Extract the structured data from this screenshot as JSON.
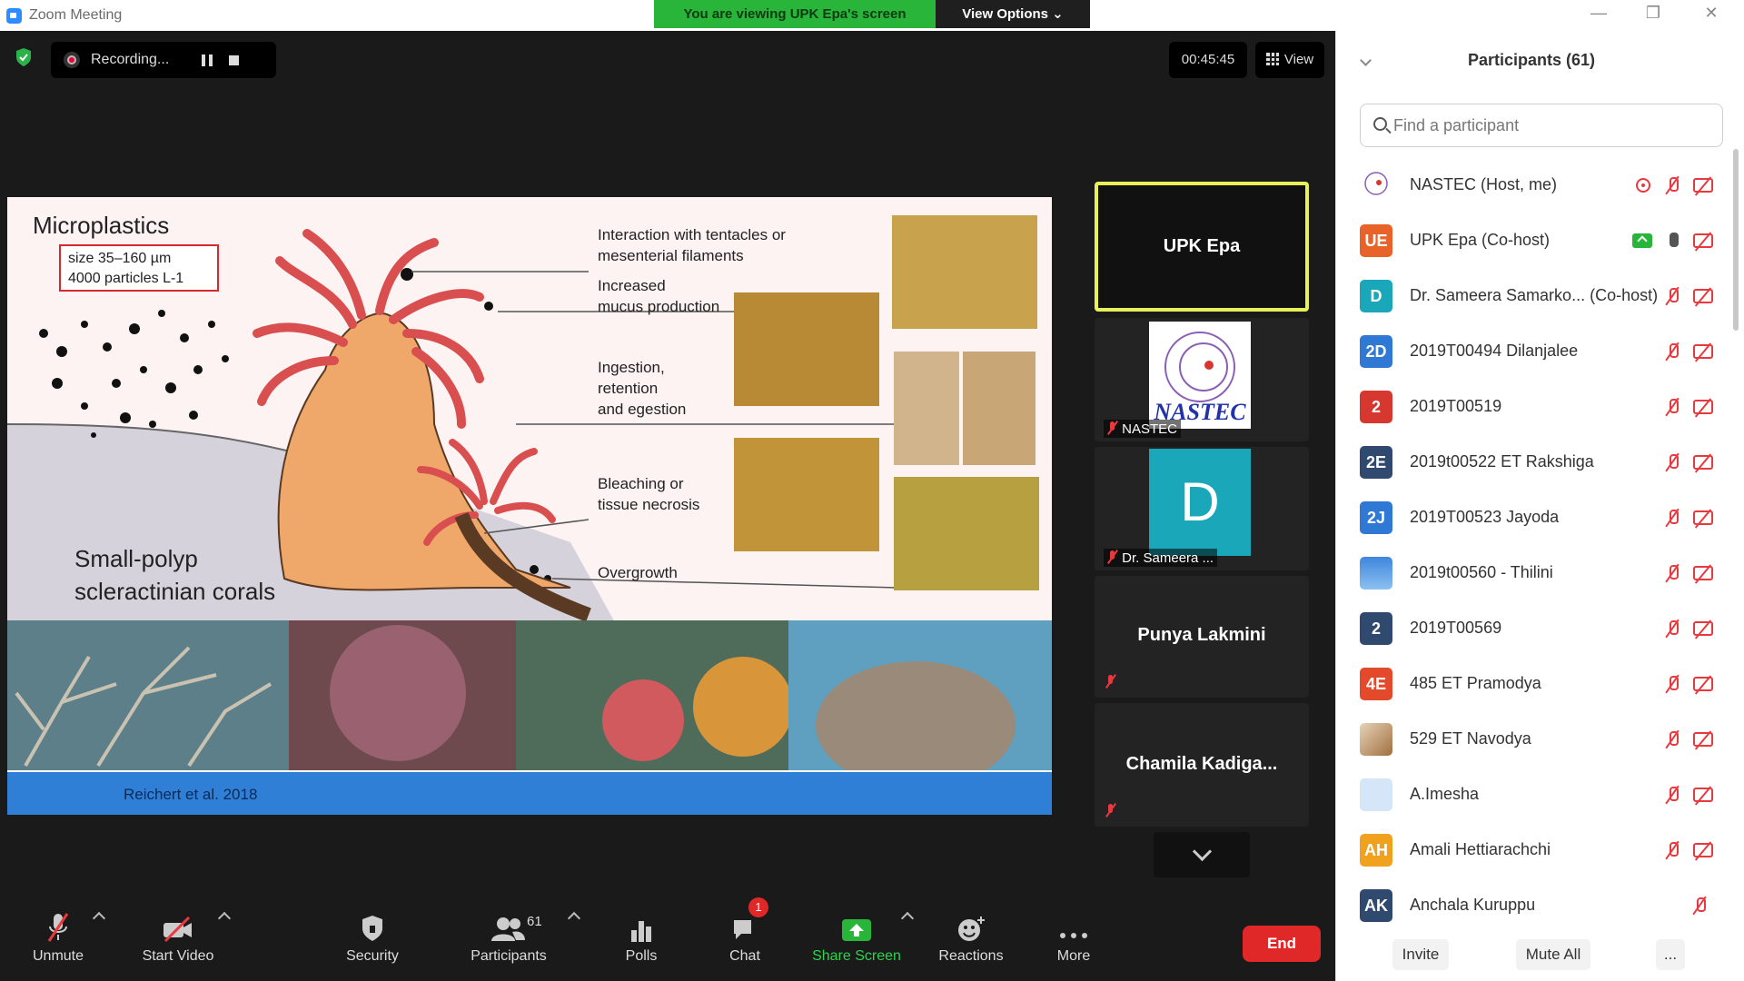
{
  "window": {
    "title": "Zoom Meeting",
    "banner": "You are viewing UPK Epa's screen",
    "view_options": "View Options ⌄",
    "minimize": "—",
    "restore": "❐",
    "close": "✕"
  },
  "meeting": {
    "recording_label": "Recording...",
    "timer": "00:45:45",
    "view_label": "View"
  },
  "slide": {
    "title": "Microplastics",
    "size_line1": "size 35–160 µm",
    "size_line2": "4000 particles L-1",
    "coral_name_line1": "Small-polyp",
    "coral_name_line2": "scleractinian corals",
    "effects": [
      {
        "line1": "Interaction with tentacles or",
        "line2": "mesenterial filaments",
        "line3": ""
      },
      {
        "line1": "Increased",
        "line2": "mucus production",
        "line3": ""
      },
      {
        "line1": "Ingestion,",
        "line2": "retention",
        "line3": "and egestion"
      },
      {
        "line1": "Bleaching or",
        "line2": "tissue necrosis",
        "line3": ""
      },
      {
        "line1": "Overgrowth",
        "line2": "",
        "line3": ""
      }
    ],
    "citation": "Reichert et al. 2018"
  },
  "video_strip": {
    "tiles": [
      {
        "name": "UPK Epa"
      },
      {
        "name": "NASTEC",
        "logo_text": "NASTEC"
      },
      {
        "name": "Dr. Sameera ...",
        "avatar_letter": "D"
      },
      {
        "name": "Punya Lakmini"
      },
      {
        "name": "Chamila  Kadiga..."
      }
    ]
  },
  "toolbar": {
    "unmute": "Unmute",
    "start_video": "Start Video",
    "security": "Security",
    "participants": "Participants",
    "participants_count": "61",
    "polls": "Polls",
    "chat": "Chat",
    "chat_badge": "1",
    "share_screen": "Share Screen",
    "reactions": "Reactions",
    "more": "More",
    "end": "End"
  },
  "panel": {
    "title": "Participants (61)",
    "search_placeholder": "Find a participant",
    "invite": "Invite",
    "mute_all": "Mute All",
    "more": "...",
    "participants": [
      {
        "initials": "",
        "name": "NASTEC (Host, me)",
        "color": "#ffffff"
      },
      {
        "initials": "UE",
        "name": "UPK Epa (Co-host)",
        "color": "#e8632a"
      },
      {
        "initials": "D",
        "name": "Dr. Sameera Samarko... (Co-host)",
        "color": "#1aa7b9"
      },
      {
        "initials": "2D",
        "name": "2019T00494 Dilanjalee",
        "color": "#2f78d4"
      },
      {
        "initials": "2",
        "name": "2019T00519",
        "color": "#d6382f"
      },
      {
        "initials": "2E",
        "name": "2019t00522 ET Rakshiga",
        "color": "#2f4a6e"
      },
      {
        "initials": "2J",
        "name": "2019T00523 Jayoda",
        "color": "#2f78d4"
      },
      {
        "initials": "",
        "name": "2019t00560 - Thilini",
        "color": "#5aa0e6"
      },
      {
        "initials": "2",
        "name": "2019T00569",
        "color": "#2f4a6e"
      },
      {
        "initials": "4E",
        "name": "485 ET Pramodya",
        "color": "#e34a2b"
      },
      {
        "initials": "",
        "name": "529 ET Navodya",
        "color": "#b88a5a"
      },
      {
        "initials": "",
        "name": "A.Imesha",
        "color": "#cfe3f7"
      },
      {
        "initials": "AH",
        "name": "Amali Hettiarachchi",
        "color": "#f0a21e"
      },
      {
        "initials": "AK",
        "name": "Anchala Kuruppu",
        "color": "#2f4a6e"
      }
    ]
  }
}
